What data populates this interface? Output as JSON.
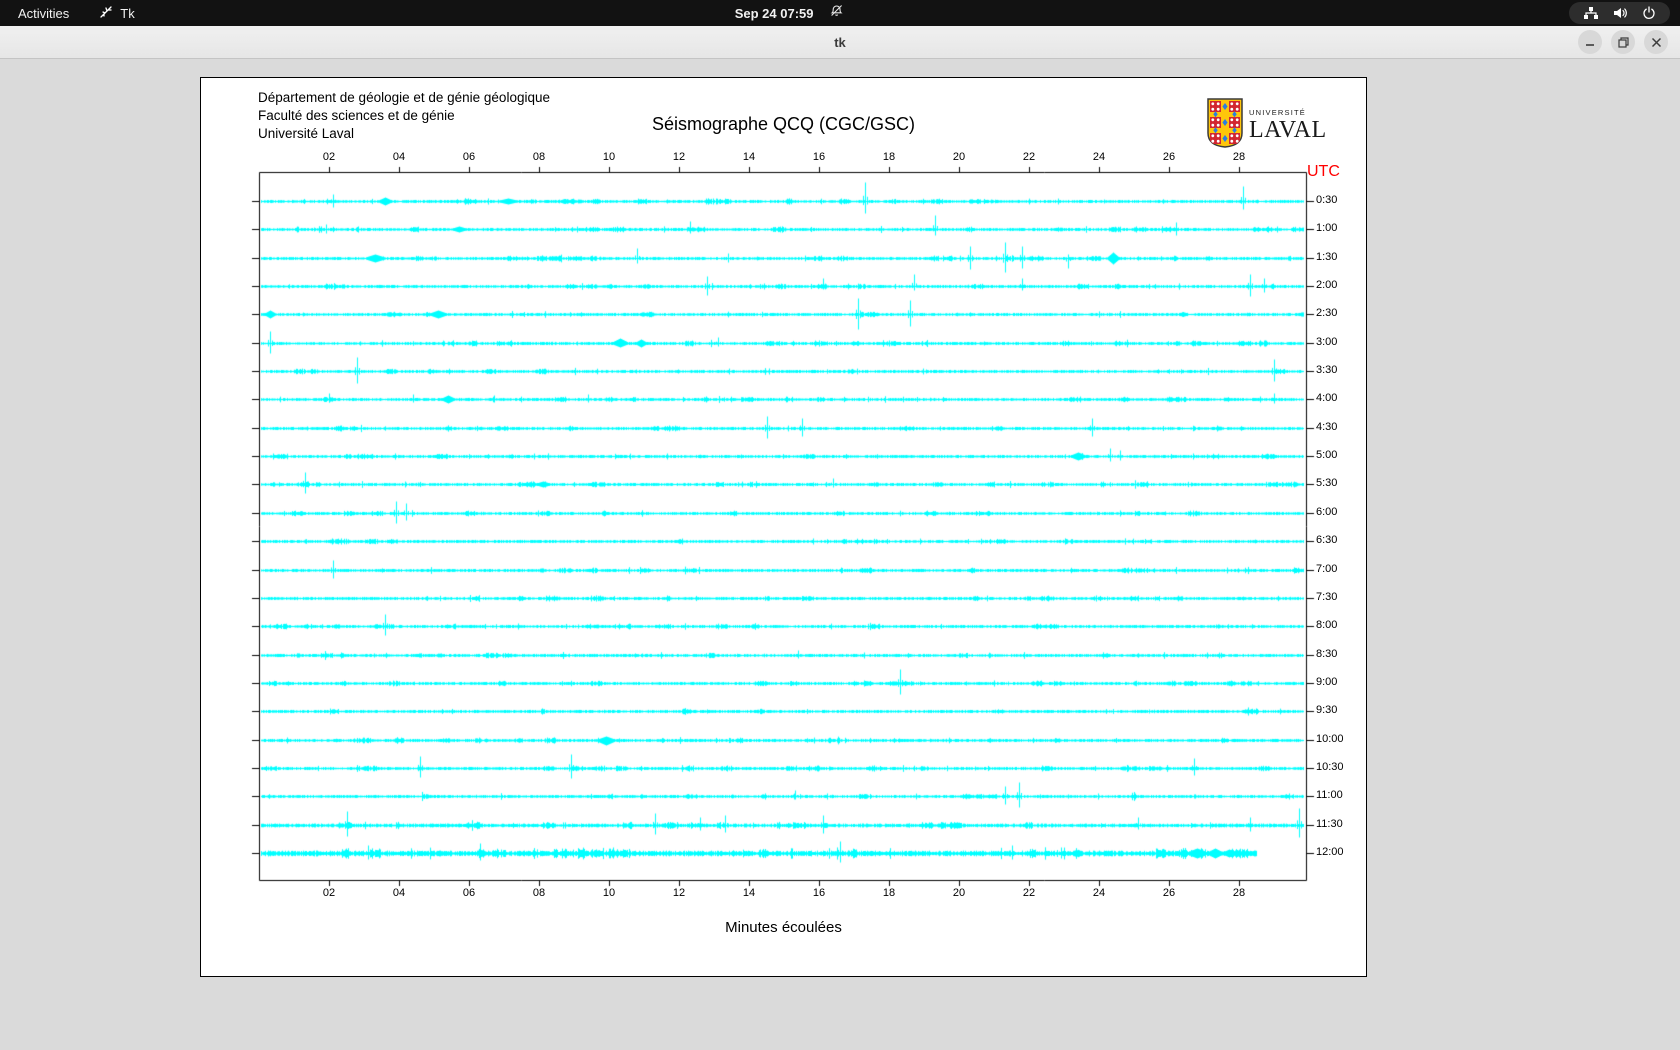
{
  "top_bar": {
    "activities_label": "Activities",
    "app_indicator": {
      "icon": "tk-feather-icon",
      "label": "Tk"
    },
    "clock": "Sep 24 07:59",
    "notifications_icon": "bell-slash-icon",
    "tray_icons": [
      "network-wired-icon",
      "volume-icon",
      "power-icon"
    ]
  },
  "window": {
    "title": "tk"
  },
  "page": {
    "org_lines": [
      "Département de géologie et de génie géologique",
      "Faculté des sciences et de génie",
      "Université Laval"
    ],
    "title": "Séismographe QCQ (CGC/GSC)",
    "logo": {
      "small_text": "UNIVERSITÉ",
      "large_text": "LAVAL"
    },
    "utc_corner_label": "UTC",
    "xlabel": "Minutes écoulées"
  },
  "chart_data": {
    "type": "line",
    "variant": "helicorder-seismogram",
    "title": "Séismographe QCQ (CGC/GSC)",
    "xlabel": "Minutes écoulées",
    "right_axis_label": "UTC",
    "trace_color": "#00ffff",
    "axis_color": "#000000",
    "utc_label_color": "#ff0000",
    "grid": false,
    "x_tick_labels": [
      "02",
      "04",
      "06",
      "08",
      "10",
      "12",
      "14",
      "16",
      "18",
      "20",
      "22",
      "24",
      "26",
      "28"
    ],
    "x_tick_minutes": [
      2,
      4,
      6,
      8,
      10,
      12,
      14,
      16,
      18,
      20,
      22,
      24,
      26,
      28
    ],
    "x_range_minutes": [
      0,
      29.9
    ],
    "rows": [
      {
        "utc": "0:30",
        "amp": 1.0,
        "end_min": 29.85,
        "spikes": [
          [
            2.1,
            7,
            6
          ],
          [
            3.6,
            4,
            4,
            6
          ],
          [
            7.1,
            3,
            3,
            9
          ],
          [
            17.3,
            19,
            12
          ],
          [
            28.1,
            15,
            8
          ]
        ]
      },
      {
        "utc": "1:00",
        "amp": 1.0,
        "end_min": 29.85,
        "spikes": [
          [
            1.9,
            5,
            4
          ],
          [
            5.7,
            3,
            3,
            7
          ],
          [
            12.3,
            8,
            4
          ],
          [
            19.3,
            14,
            6
          ],
          [
            26.2,
            7,
            6
          ]
        ]
      },
      {
        "utc": "1:30",
        "amp": 1.0,
        "end_min": 29.85,
        "spikes": [
          [
            3.3,
            4,
            4,
            9
          ],
          [
            10.8,
            10,
            5
          ],
          [
            13.4,
            5,
            4
          ],
          [
            20.3,
            12,
            11
          ],
          [
            21.3,
            16,
            14
          ],
          [
            21.8,
            12,
            10
          ],
          [
            23.1,
            4,
            10
          ],
          [
            24.4,
            6,
            6,
            5
          ]
        ]
      },
      {
        "utc": "2:00",
        "amp": 1.0,
        "end_min": 29.85,
        "spikes": [
          [
            12.8,
            10,
            9
          ],
          [
            16.1,
            8,
            3
          ],
          [
            18.7,
            12,
            4
          ],
          [
            21.8,
            8,
            4
          ],
          [
            28.3,
            12,
            10
          ],
          [
            28.7,
            8,
            6
          ]
        ]
      },
      {
        "utc": "2:30",
        "amp": 1.0,
        "end_min": 29.85,
        "spikes": [
          [
            0.3,
            4,
            4,
            5
          ],
          [
            5.1,
            4,
            4,
            8
          ],
          [
            17.1,
            16,
            15
          ],
          [
            18.6,
            14,
            12
          ]
        ]
      },
      {
        "utc": "3:00",
        "amp": 1.0,
        "end_min": 29.85,
        "spikes": [
          [
            0.3,
            12,
            10
          ],
          [
            10.3,
            5,
            4,
            7
          ],
          [
            10.9,
            4,
            4,
            5
          ],
          [
            13.1,
            6,
            3
          ]
        ]
      },
      {
        "utc": "3:30",
        "amp": 1.0,
        "end_min": 29.85,
        "spikes": [
          [
            2.8,
            14,
            12
          ],
          [
            29.0,
            12,
            10
          ]
        ]
      },
      {
        "utc": "4:00",
        "amp": 1.0,
        "end_min": 29.85,
        "spikes": [
          [
            2.0,
            6,
            3
          ],
          [
            4.4,
            5,
            3
          ],
          [
            5.4,
            4,
            4,
            6
          ],
          [
            6.7,
            4,
            3
          ],
          [
            9.4,
            5,
            3
          ],
          [
            29.0,
            6,
            4
          ]
        ]
      },
      {
        "utc": "4:30",
        "amp": 1.0,
        "end_min": 29.85,
        "spikes": [
          [
            14.5,
            12,
            10
          ],
          [
            15.5,
            10,
            8
          ],
          [
            23.8,
            10,
            8
          ]
        ]
      },
      {
        "utc": "5:00",
        "amp": 1.0,
        "end_min": 29.85,
        "spikes": [
          [
            23.4,
            4,
            4,
            7
          ],
          [
            24.3,
            8,
            5
          ],
          [
            24.6,
            6,
            4
          ]
        ]
      },
      {
        "utc": "5:30",
        "amp": 1.0,
        "end_min": 29.85,
        "spikes": [
          [
            1.3,
            12,
            9
          ],
          [
            8.1,
            3,
            3,
            7
          ],
          [
            16.4,
            6,
            3
          ]
        ]
      },
      {
        "utc": "6:00",
        "amp": 1.0,
        "end_min": 29.85,
        "spikes": [
          [
            3.9,
            12,
            10
          ],
          [
            4.2,
            10,
            7
          ]
        ]
      },
      {
        "utc": "6:30",
        "amp": 1.0,
        "end_min": 29.85,
        "spikes": []
      },
      {
        "utc": "7:00",
        "amp": 1.0,
        "end_min": 29.85,
        "spikes": [
          [
            2.1,
            10,
            8
          ]
        ]
      },
      {
        "utc": "7:30",
        "amp": 1.0,
        "end_min": 29.85,
        "spikes": []
      },
      {
        "utc": "8:00",
        "amp": 1.0,
        "end_min": 29.85,
        "spikes": [
          [
            3.6,
            12,
            9
          ]
        ]
      },
      {
        "utc": "8:30",
        "amp": 1.0,
        "end_min": 29.85,
        "spikes": [
          [
            15.4,
            5,
            3
          ]
        ]
      },
      {
        "utc": "9:00",
        "amp": 1.0,
        "end_min": 29.85,
        "spikes": [
          [
            18.3,
            14,
            11
          ]
        ]
      },
      {
        "utc": "9:30",
        "amp": 1.0,
        "end_min": 29.85,
        "spikes": []
      },
      {
        "utc": "10:00",
        "amp": 1.0,
        "end_min": 29.85,
        "spikes": [
          [
            9.9,
            4,
            5,
            8
          ]
        ]
      },
      {
        "utc": "10:30",
        "amp": 1.0,
        "end_min": 29.85,
        "spikes": [
          [
            4.6,
            12,
            9
          ],
          [
            8.9,
            14,
            10
          ],
          [
            26.7,
            10,
            7
          ]
        ]
      },
      {
        "utc": "11:00",
        "amp": 1.0,
        "end_min": 29.85,
        "spikes": [
          [
            15.3,
            6,
            3
          ],
          [
            21.3,
            10,
            8
          ],
          [
            21.7,
            14,
            11
          ]
        ]
      },
      {
        "utc": "11:30",
        "amp": 1.25,
        "end_min": 29.85,
        "spikes": [
          [
            2.5,
            14,
            11
          ],
          [
            11.3,
            12,
            9
          ],
          [
            12.6,
            8,
            5
          ],
          [
            13.3,
            10,
            7
          ],
          [
            16.1,
            10,
            8
          ],
          [
            25.1,
            8,
            4
          ],
          [
            28.3,
            8,
            6
          ],
          [
            29.7,
            17,
            12
          ]
        ]
      },
      {
        "utc": "12:00",
        "amp": 1.85,
        "end_min": 28.5,
        "spikes": [
          [
            3.1,
            8,
            6
          ],
          [
            6.3,
            10,
            7
          ],
          [
            10.1,
            6,
            5
          ],
          [
            16.6,
            12,
            9
          ],
          [
            21.5,
            8,
            6
          ],
          [
            22.9,
            6,
            5
          ],
          [
            26.8,
            5,
            5,
            9
          ],
          [
            27.3,
            5,
            5,
            7
          ],
          [
            27.7,
            4,
            4,
            6
          ]
        ]
      }
    ]
  }
}
